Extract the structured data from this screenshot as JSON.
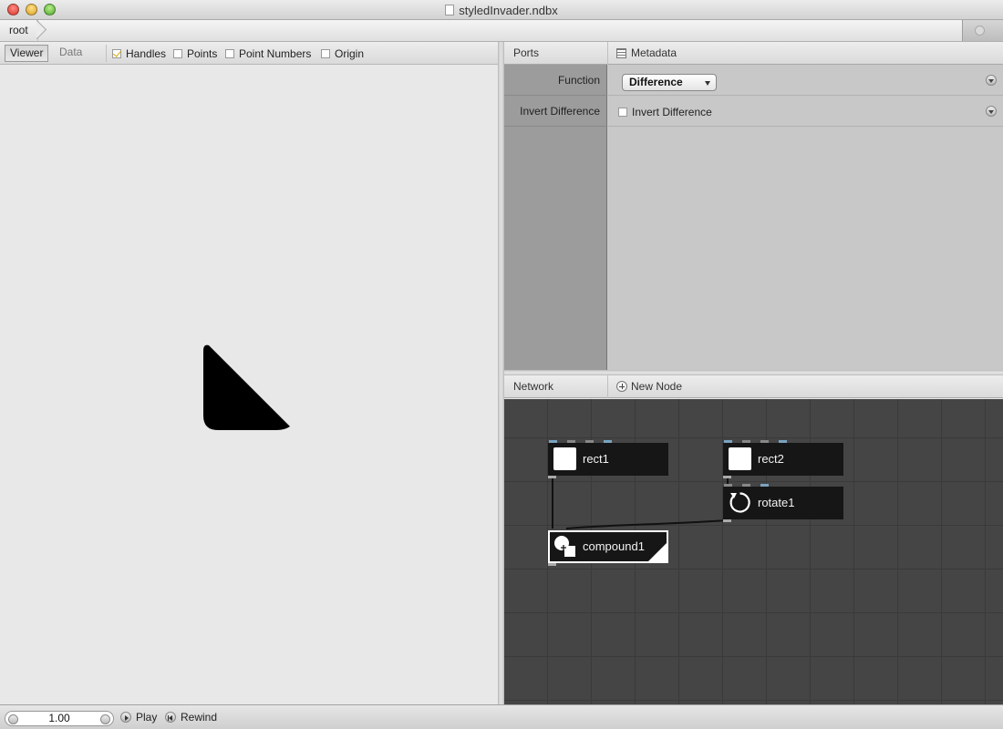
{
  "window": {
    "title": "styledInvader.ndbx"
  },
  "breadcrumb": {
    "items": [
      "root"
    ]
  },
  "viewer": {
    "tabs": [
      {
        "label": "Viewer",
        "active": true
      },
      {
        "label": "Data",
        "active": false
      }
    ],
    "options": [
      {
        "label": "Handles",
        "checked": true
      },
      {
        "label": "Points",
        "checked": false
      },
      {
        "label": "Point Numbers",
        "checked": false
      },
      {
        "label": "Origin",
        "checked": false
      }
    ]
  },
  "ports": {
    "header": {
      "ports_label": "Ports",
      "metadata_label": "Metadata"
    },
    "rows": [
      {
        "label": "Function",
        "control": "select",
        "value": "Difference"
      },
      {
        "label": "Invert Difference",
        "control": "checkbox",
        "checkbox_label": "Invert Difference",
        "checked": false
      }
    ]
  },
  "network": {
    "header": {
      "network_label": "Network",
      "new_node_label": "New Node"
    },
    "nodes": [
      {
        "name": "rect1",
        "icon": "rect-icon",
        "selected": false
      },
      {
        "name": "rect2",
        "icon": "rect-icon",
        "selected": false
      },
      {
        "name": "rotate1",
        "icon": "rotate-icon",
        "selected": false
      },
      {
        "name": "compound1",
        "icon": "compound-icon",
        "selected": true,
        "rendered": true
      }
    ],
    "connections": [
      {
        "from": "rect1",
        "to": "compound1"
      },
      {
        "from": "rect2",
        "to": "rotate1"
      },
      {
        "from": "rotate1",
        "to": "compound1"
      }
    ]
  },
  "playback": {
    "frame": "1.00",
    "play_label": "Play",
    "rewind_label": "Rewind"
  },
  "colors": {
    "network_bg": "#454545",
    "node_bg": "#161616",
    "port_stub_highlight": "#7aa3c0",
    "shape_fill": "#000000",
    "handles_check": "#d4a300"
  }
}
